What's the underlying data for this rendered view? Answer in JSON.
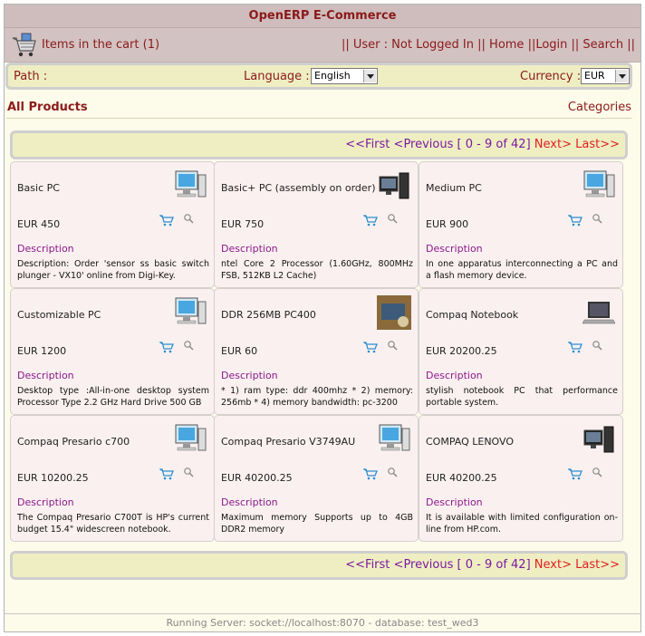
{
  "header": {
    "title": "OpenERP E-Commerce"
  },
  "cart": {
    "label": "Items in the cart (1)"
  },
  "user_links": [
    "|| User : Not Logged In",
    " || Home",
    " ||Login",
    " || Search ||"
  ],
  "path": {
    "label": "Path :"
  },
  "language": {
    "label": "Language :",
    "value": "English"
  },
  "currency": {
    "label": "Currency :",
    "value": "EUR"
  },
  "main": {
    "heading": "All Products",
    "categories": "Categories"
  },
  "pager": {
    "first": "<<First",
    "previous": "<Previous",
    "range": "[ 0 - 9 of 42]",
    "next": "Next>",
    "last": "Last>>"
  },
  "desc_label": "Description",
  "products": [
    {
      "name": "Basic PC",
      "price": "EUR 450",
      "desc": "Description: Order 'sensor ss basic switch plunger - VX10' online from Digi-Key.",
      "icon": "desktop-pc-icon"
    },
    {
      "name": "Basic+ PC (assembly on order)",
      "price": "EUR 750",
      "desc": "ntel Core 2 Processor (1.60GHz, 800MHz FSB, 512KB L2 Cache)",
      "icon": "tower-pc-icon"
    },
    {
      "name": "Medium PC",
      "price": "EUR 900",
      "desc": "In one apparatus interconnecting a PC and a flash memory device.",
      "icon": "desktop-pc-icon"
    },
    {
      "name": "Customizable PC",
      "price": "EUR 1200",
      "desc": "Desktop type :All-in-one desktop system Processor Type 2.2 GHz Hard Drive 500 GB",
      "icon": "desktop-pc-icon"
    },
    {
      "name": "DDR 256MB PC400",
      "price": "EUR 60",
      "desc": "* 1) ram type: ddr 400mhz * 2) memory: 256mb * 4) memory bandwidth: pc-3200",
      "icon": "photo-icon"
    },
    {
      "name": "Compaq Notebook",
      "price": "EUR 20200.25",
      "desc": "stylish notebook PC that performance portable system.",
      "icon": "laptop-icon"
    },
    {
      "name": "Compaq Presario c700",
      "price": "EUR 10200.25",
      "desc": "The Compaq Presario C700T is HP's current budget 15.4\" widescreen notebook.",
      "icon": "desktop-pc-icon"
    },
    {
      "name": "Compaq Presario V3749AU",
      "price": "EUR 40200.25",
      "desc": "Maximum memory Supports up to 4GB DDR2 memory",
      "icon": "desktop-pc-icon"
    },
    {
      "name": "COMPAQ LENOVO",
      "price": "EUR 40200.25",
      "desc": "It is available with limited configuration on-line from HP.com.",
      "icon": "tower-pc-icon"
    }
  ],
  "footer": {
    "text": "Running Server: socket://localhost:8070 - database: test_wed3"
  },
  "colors": {
    "accent": "#8b1a1a",
    "title_bg": "#cfbcbc",
    "bar_bg": "#efeec2",
    "card_bg": "#faf0f0"
  }
}
